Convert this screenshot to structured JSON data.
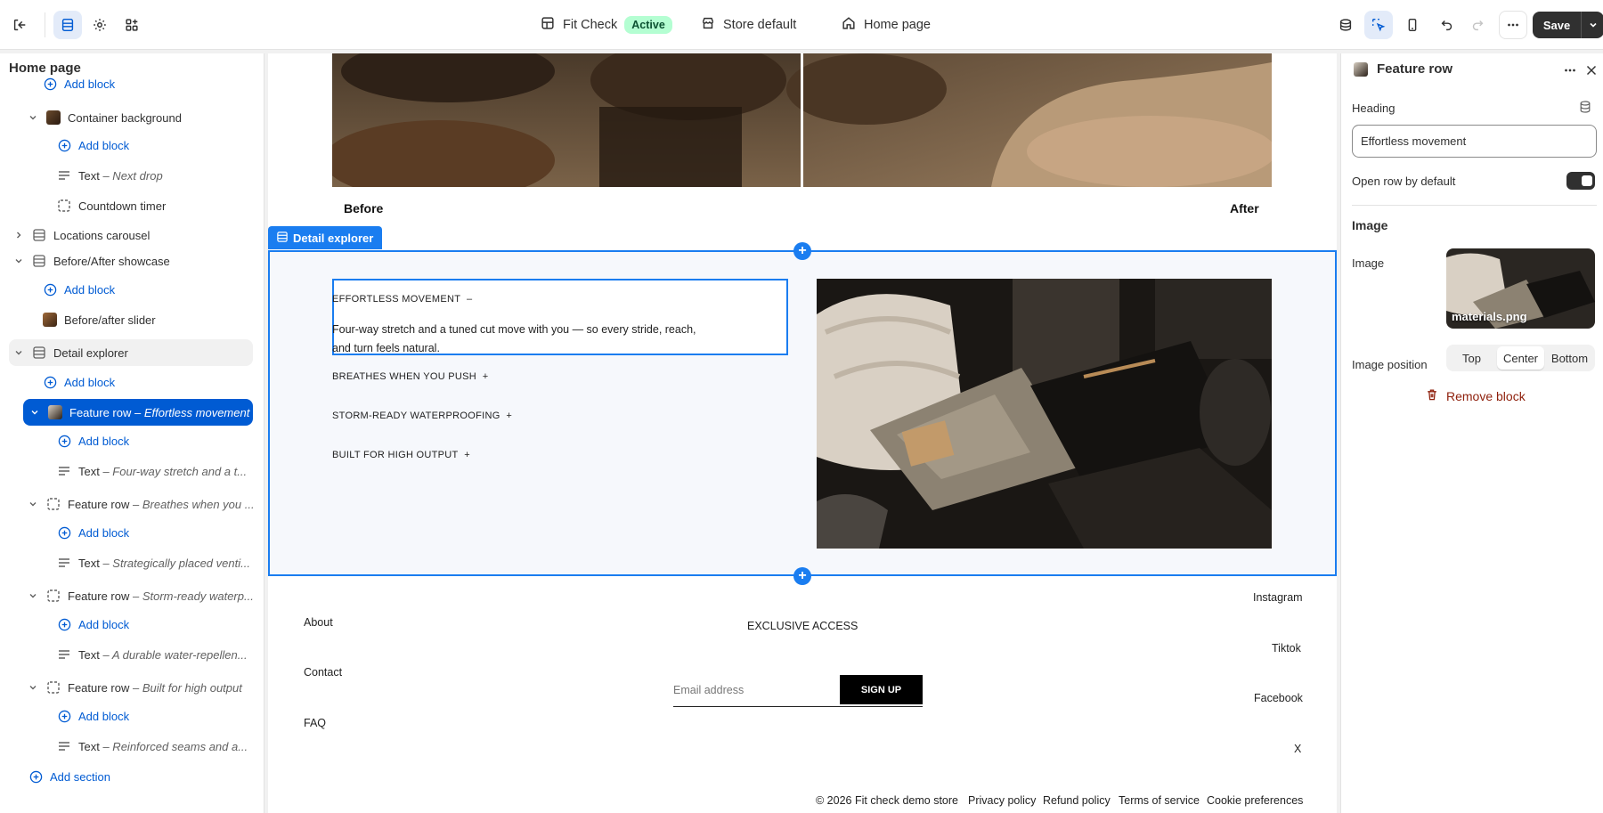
{
  "topbar": {
    "theme_name": "Fit Check",
    "theme_status": "Active",
    "market": "Store default",
    "template": "Home page",
    "save_label": "Save"
  },
  "sidebar": {
    "title": "Home page",
    "items": [
      {
        "label": "Add block",
        "sub": ""
      },
      {
        "label": "Container background",
        "sub": ""
      },
      {
        "label": "Add block",
        "sub": ""
      },
      {
        "label": "Text",
        "sub": "– Next drop"
      },
      {
        "label": "Countdown timer",
        "sub": ""
      },
      {
        "label": "Locations carousel",
        "sub": ""
      },
      {
        "label": "Before/After showcase",
        "sub": ""
      },
      {
        "label": "Add block",
        "sub": ""
      },
      {
        "label": "Before/after slider",
        "sub": ""
      },
      {
        "label": "Detail explorer",
        "sub": ""
      },
      {
        "label": "Add block",
        "sub": ""
      },
      {
        "label": "Feature row",
        "sub": "– Effortless movement"
      },
      {
        "label": "Add block",
        "sub": ""
      },
      {
        "label": "Text",
        "sub": "– Four-way stretch and a t..."
      },
      {
        "label": "Feature row",
        "sub": "– Breathes when you ..."
      },
      {
        "label": "Add block",
        "sub": ""
      },
      {
        "label": "Text",
        "sub": "– Strategically placed venti..."
      },
      {
        "label": "Feature row",
        "sub": "– Storm-ready waterp..."
      },
      {
        "label": "Add block",
        "sub": ""
      },
      {
        "label": "Text",
        "sub": "– A durable water-repellen..."
      },
      {
        "label": "Feature row",
        "sub": "– Built for high output"
      },
      {
        "label": "Add block",
        "sub": ""
      },
      {
        "label": "Text",
        "sub": "– Reinforced seams and a..."
      },
      {
        "label": "Add section",
        "sub": ""
      }
    ]
  },
  "canvas": {
    "before_label": "Before",
    "after_label": "After",
    "section_tag": "Detail explorer",
    "accordion": [
      {
        "heading": "EFFORTLESS MOVEMENT",
        "toggle": "–",
        "text": "Four-way stretch and a tuned cut move with you — so every stride, reach, and turn feels natural."
      },
      {
        "heading": "BREATHES WHEN YOU PUSH",
        "toggle": "+"
      },
      {
        "heading": "STORM-READY WATERPROOFING",
        "toggle": "+"
      },
      {
        "heading": "BUILT FOR HIGH OUTPUT",
        "toggle": "+"
      }
    ],
    "footer": {
      "links_left": [
        "About",
        "Contact",
        "FAQ"
      ],
      "newsletter_title": "EXCLUSIVE ACCESS",
      "email_placeholder": "Email address",
      "signup_label": "SIGN UP",
      "social": [
        "Instagram",
        "Tiktok",
        "Facebook",
        "X"
      ],
      "copyright": "© 2026 Fit check demo store",
      "policies": [
        "Privacy policy",
        "Refund policy",
        "Terms of service",
        "Cookie preferences"
      ]
    }
  },
  "panel": {
    "title": "Feature row",
    "heading_label": "Heading",
    "heading_value": "Effortless movement",
    "open_label": "Open row by default",
    "open_value": true,
    "image_section": "Image",
    "image_label": "Image",
    "image_file": "materials.png",
    "position_label": "Image position",
    "position_options": [
      "Top",
      "Center",
      "Bottom"
    ],
    "position_selected": "Center",
    "remove_label": "Remove block"
  },
  "colors": {
    "accent": "#005bd3",
    "selection_outline": "#1a7df0",
    "active_badge_bg": "#b4fed2",
    "danger": "#8e1f0b"
  }
}
